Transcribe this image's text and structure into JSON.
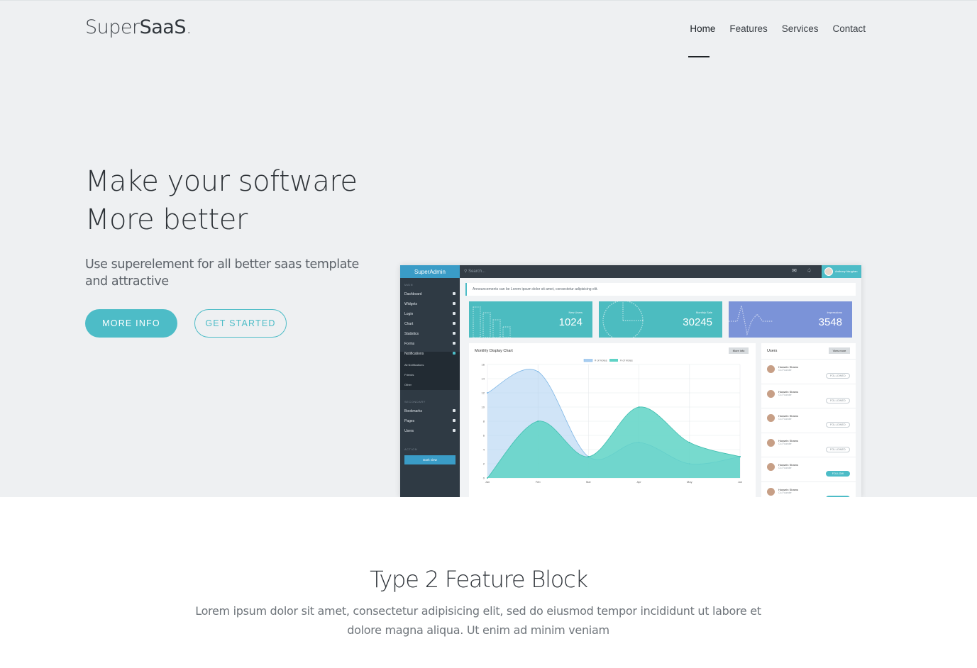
{
  "brand": {
    "light": "Super",
    "bold": "SaaS",
    "dot": "."
  },
  "nav": [
    {
      "label": "Home",
      "active": true
    },
    {
      "label": "Features",
      "active": false
    },
    {
      "label": "Services",
      "active": false
    },
    {
      "label": "Contact",
      "active": false
    }
  ],
  "hero": {
    "title_line1": "Make your software",
    "title_line2": "More better",
    "subtitle": "Use superelement for all better saas template and attractive",
    "primary_button": "MORE INFO",
    "secondary_button": "GET STARTED"
  },
  "mockup": {
    "brand": "SuperAdmin",
    "search_placeholder": "Search...",
    "user_name": "Anthony Vaughan",
    "announcement": "Announcements can be Lorem ipsum dolor sit amet, consectetur adipisicing elit.",
    "sidebar": {
      "main_label": "MAIN",
      "main_items": [
        "Dashboard",
        "Widgets",
        "Login",
        "Chart",
        "Statistics",
        "Forms",
        "Notifications"
      ],
      "sub_items": [
        "All Notifications",
        "Friends",
        "Other"
      ],
      "secondary_label": "SECONDARY",
      "secondary_items": [
        "Bookmarks",
        "Pages",
        "Users"
      ],
      "action_label": "ACTION",
      "action_button": "Dark view"
    },
    "stats": [
      {
        "label": "New Users",
        "value": "1024",
        "color": "#4cbcc0"
      },
      {
        "label": "Monthly Sale",
        "value": "30245",
        "color": "#4cbcc0"
      },
      {
        "label": "Impressions",
        "value": "3548",
        "color": "#7b93d8"
      }
    ],
    "chart": {
      "title": "Monthly Display Chart",
      "button": "More info",
      "legend": [
        "# of Votes",
        "# of Votes"
      ]
    },
    "users": {
      "title": "Users",
      "button": "View more",
      "rows": [
        {
          "name": "Hossein Shams",
          "role": "Co-Founder",
          "action": "FOLLOWED",
          "following": false
        },
        {
          "name": "Hossein Shams",
          "role": "Co-Founder",
          "action": "FOLLOWED",
          "following": false
        },
        {
          "name": "Hossein Shams",
          "role": "Co-Founder",
          "action": "FOLLOWED",
          "following": false
        },
        {
          "name": "Hossein Shams",
          "role": "Co-Founder",
          "action": "FOLLOWED",
          "following": false
        },
        {
          "name": "Hossein Shams",
          "role": "Co-Founder",
          "action": "FOLLOW",
          "following": true
        },
        {
          "name": "Hossein Shams",
          "role": "Co-Founder",
          "action": "FOLLOW",
          "following": true
        }
      ]
    }
  },
  "chart_data": {
    "type": "area",
    "categories": [
      "Jan",
      "Feb",
      "Mar",
      "Apr",
      "May",
      "Jun"
    ],
    "series": [
      {
        "values": [
          12,
          15,
          3,
          5,
          2,
          3
        ],
        "color": "#a9cdf0"
      },
      {
        "values": [
          0,
          8,
          3,
          10,
          5,
          3
        ],
        "color": "#5fd3c6"
      }
    ],
    "yticks": [
      "0",
      "2",
      "4",
      "6",
      "8",
      "10",
      "12",
      "14",
      "16"
    ],
    "ylim": [
      0,
      16
    ],
    "grid": true,
    "legend": "top-center"
  },
  "feature": {
    "title": "Type 2 Feature Block",
    "text": "Lorem ipsum dolor sit amet, consectetur adipisicing elit, sed do eiusmod tempor incididunt ut labore et dolore magna aliqua. Ut enim ad minim veniam"
  }
}
